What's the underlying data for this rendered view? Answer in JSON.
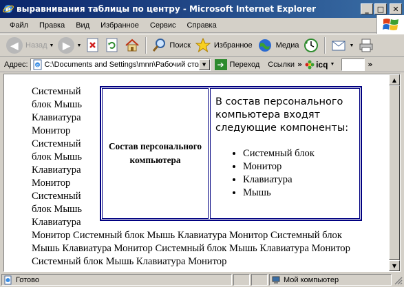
{
  "window": {
    "title": "выравнивания таблицы по центру - Microsoft Internet Explorer",
    "controls": {
      "minimize": "_",
      "maximize": "□",
      "close": "✕"
    }
  },
  "menu": [
    "Файл",
    "Правка",
    "Вид",
    "Избранное",
    "Сервис",
    "Справка"
  ],
  "toolbar": {
    "back": "Назад",
    "search": "Поиск",
    "favorites": "Избранное",
    "media": "Медиа"
  },
  "address": {
    "label": "Адрес:",
    "value": "C:\\Documents and Settings\\mnn\\Рабочий стол",
    "go": "Переход",
    "links": "Ссылки",
    "icq": "icq"
  },
  "content": {
    "table_heading": "Состав персонального компьютера",
    "intro": "В состав персонального компьютера входят следующие компоненты:",
    "components": [
      "Системный блок",
      "Монитор",
      "Клавиатура",
      "Мышь"
    ],
    "flow_text": "Системный блок Мышь Клавиатура Монитор Системный блок Мышь Клавиатура Монитор Системный блок Мышь Клавиатура Монитор Системный блок Мышь Клавиатура Монитор Системный блок Мышь Клавиатура Монитор Системный блок Мышь Клавиатура Монитор Системный блок Мышь Клавиатура Монитор"
  },
  "status": {
    "text": "Готово",
    "zone": "Мой компьютер"
  },
  "colors": {
    "titlebar_start": "#0a246a",
    "titlebar_end": "#3a6ea5",
    "chrome": "#d4d0c8",
    "table_border": "#000080"
  }
}
